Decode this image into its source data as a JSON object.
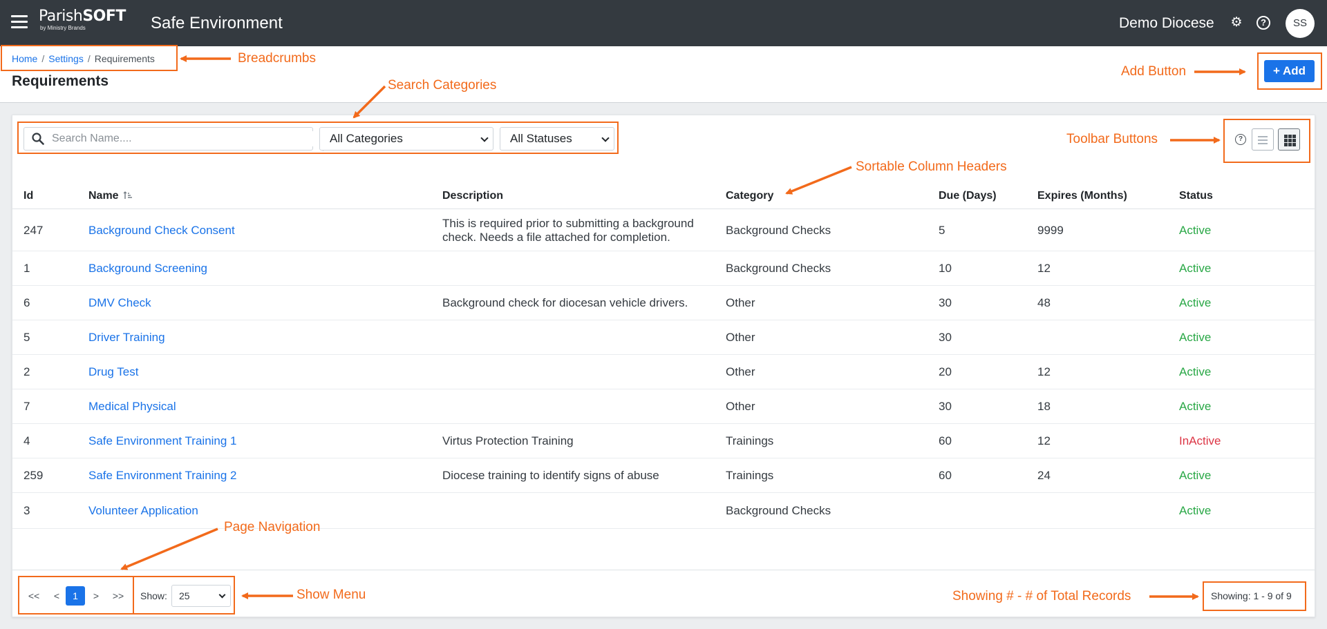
{
  "topbar": {
    "logo_main_a": "Parish",
    "logo_main_b": "SOFT",
    "logo_sub": "by Ministry Brands",
    "app_title": "Safe Environment",
    "org_name": "Demo Diocese",
    "avatar_initials": "SS",
    "help_glyph": "?"
  },
  "breadcrumb": {
    "items": [
      "Home",
      "Settings"
    ],
    "current": "Requirements",
    "separator": "/"
  },
  "page": {
    "title": "Requirements",
    "add_label": "Add",
    "add_plus": "+"
  },
  "filters": {
    "search_placeholder": "Search Name....",
    "category": "All Categories",
    "status": "All Statuses"
  },
  "toolbar": {
    "help_glyph": "?"
  },
  "table": {
    "columns": [
      "Id",
      "Name",
      "Description",
      "Category",
      "Due (Days)",
      "Expires (Months)",
      "Status"
    ],
    "rows": [
      {
        "id": "247",
        "name": "Background Check Consent",
        "desc1": "This is required prior to submitting a background",
        "desc2": "check. Needs a file attached for completion.",
        "category": "Background Checks",
        "due": "5",
        "expires": "9999",
        "status": "Active"
      },
      {
        "id": "1",
        "name": "Background Screening",
        "desc1": "",
        "desc2": "",
        "category": "Background Checks",
        "due": "10",
        "expires": "12",
        "status": "Active"
      },
      {
        "id": "6",
        "name": "DMV Check",
        "desc1": "Background check for diocesan vehicle drivers.",
        "desc2": "",
        "category": "Other",
        "due": "30",
        "expires": "48",
        "status": "Active"
      },
      {
        "id": "5",
        "name": "Driver Training",
        "desc1": "",
        "desc2": "",
        "category": "Other",
        "due": "30",
        "expires": "",
        "status": "Active"
      },
      {
        "id": "2",
        "name": "Drug Test",
        "desc1": "",
        "desc2": "",
        "category": "Other",
        "due": "20",
        "expires": "12",
        "status": "Active"
      },
      {
        "id": "7",
        "name": "Medical Physical",
        "desc1": "",
        "desc2": "",
        "category": "Other",
        "due": "30",
        "expires": "18",
        "status": "Active"
      },
      {
        "id": "4",
        "name": "Safe Environment Training 1",
        "desc1": "Virtus Protection Training",
        "desc2": "",
        "category": "Trainings",
        "due": "60",
        "expires": "12",
        "status": "InActive"
      },
      {
        "id": "259",
        "name": "Safe Environment Training 2",
        "desc1": "Diocese training to identify signs of abuse",
        "desc2": "",
        "category": "Trainings",
        "due": "60",
        "expires": "24",
        "status": "Active"
      },
      {
        "id": "3",
        "name": "Volunteer Application",
        "desc1": "",
        "desc2": "",
        "category": "Background Checks",
        "due": "",
        "expires": "",
        "status": "Active"
      }
    ]
  },
  "pagination": {
    "first": "<<",
    "prev": "<",
    "current": "1",
    "next": ">",
    "last": ">>",
    "show_label": "Show:",
    "page_size": "25",
    "showing": "Showing: 1 - 9 of 9"
  },
  "annotations": {
    "breadcrumbs": "Breadcrumbs",
    "search_categories": "Search Categories",
    "add_button": "Add Button",
    "toolbar_buttons": "Toolbar Buttons",
    "sortable_headers": "Sortable Column Headers",
    "page_navigation": "Page Navigation",
    "show_menu": "Show Menu",
    "showing_records": "Showing # - # of Total Records"
  },
  "colors": {
    "topbar": "#343a40",
    "accent": "#1a73e8",
    "annotation": "#f26a1b",
    "active": "#28a745",
    "inactive": "#dc3545"
  }
}
